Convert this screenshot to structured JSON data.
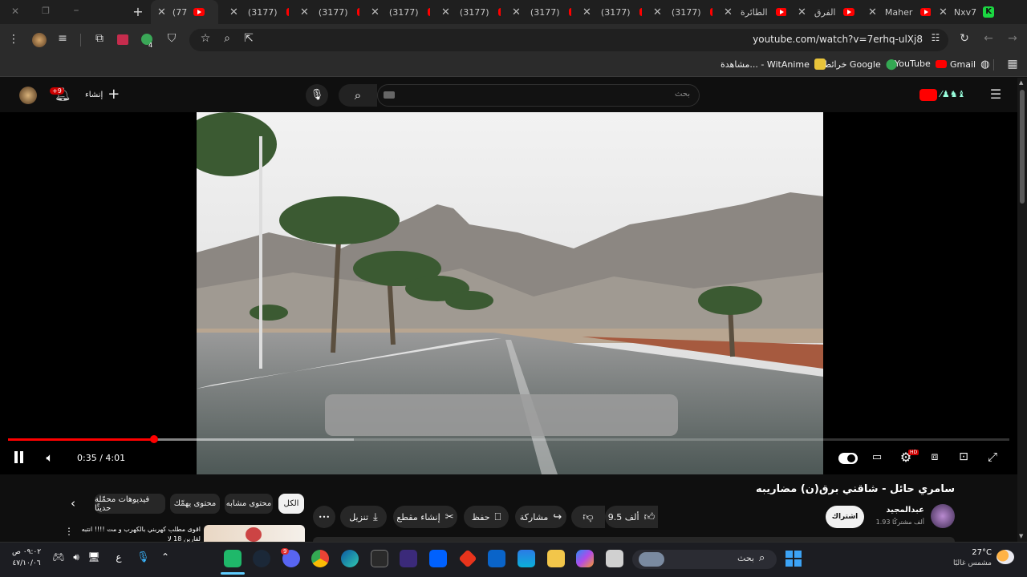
{
  "browser": {
    "tabs": [
      {
        "label": "(77",
        "active": true
      },
      {
        "label": "(3177)"
      },
      {
        "label": "(3177)"
      },
      {
        "label": "(3177)"
      },
      {
        "label": "(3177)"
      },
      {
        "label": "(3177)"
      },
      {
        "label": "(3177)"
      },
      {
        "label": "(3177)"
      },
      {
        "label": "الطائرة"
      },
      {
        "label": "الفرق"
      },
      {
        "label": "Maher"
      },
      {
        "label": "Nxv7"
      }
    ],
    "new_tab": "+",
    "url": "youtube.com/watch?v=7erhq-ulXj8",
    "bookmarks": [
      {
        "label": "Gmail"
      },
      {
        "label": "YouTube"
      },
      {
        "label": "خرائط Google"
      },
      {
        "label": "مشاهدة... - WitAnime"
      }
    ]
  },
  "youtube": {
    "search_placeholder": "بحث",
    "create_label": "إنشاء",
    "notification_badge": "+9",
    "player": {
      "time": "0:35 / 4:01",
      "progress_fraction": 0.146,
      "buffer_fraction": 0.345,
      "hd_badge": "HD"
    },
    "video": {
      "title": "سامري حائل - شاقني برق(ن) مضاريبه",
      "channel": "عبدالمجيد",
      "subscribers": "1.93 ألف مشتركًا",
      "subscribe_label": "اشتراك",
      "likes": "9.5 ألف",
      "share_label": "مشاركة",
      "save_label": "حفظ",
      "clip_label": "إنشاء مقطع",
      "download_label": "تنزيل",
      "more_label": "•••"
    },
    "chips": [
      "الكل",
      "محتوى مشابه",
      "محتوى يهمّك",
      "فيديوهات محمّلة حديثًا"
    ],
    "recommendation": {
      "title_line1": "اقوى مطلب كهربني بالكهرب و مت !!!! انتبه",
      "title_line2": "لقارين 18 لا"
    }
  },
  "taskbar": {
    "search_placeholder": "بحث",
    "weather_temp": "27°C",
    "weather_desc": "مشمس غالبًا",
    "clock_time": "٠٩:٠٢ ص",
    "clock_date": "٤٧/١٠/٠٦",
    "lang": "ع",
    "discord_badge": "9"
  }
}
